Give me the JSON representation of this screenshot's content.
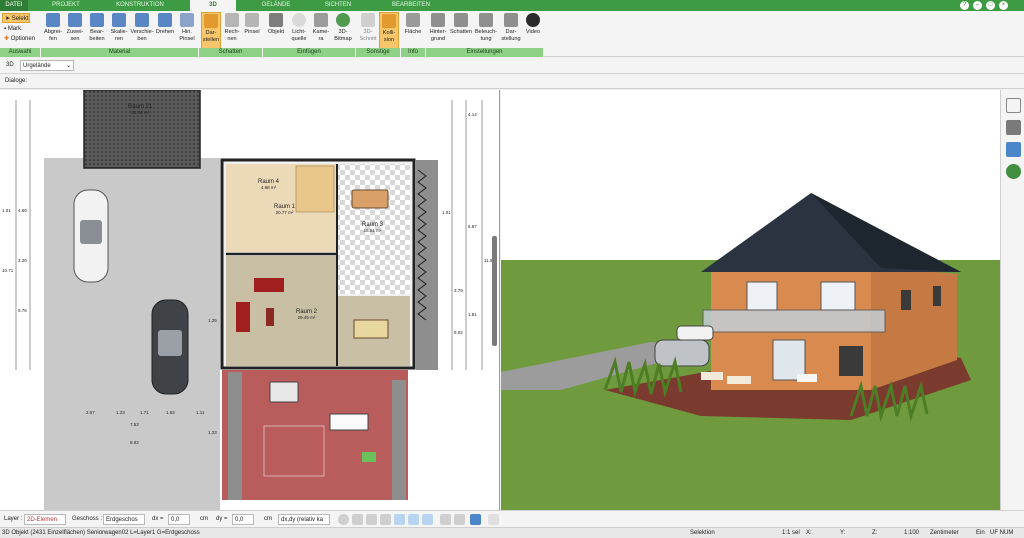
{
  "tabs": [
    "DATEI",
    "PROJEKT",
    "KONSTRUKTION",
    "3D",
    "GELÄNDE",
    "SICHTEN",
    "BEARBEITEN"
  ],
  "active_tab": "3D",
  "window_controls": [
    "?",
    "–",
    "□",
    "×"
  ],
  "ribbon": {
    "selection": {
      "select": "Selekt",
      "mark": "Mark.",
      "options": "Optionen"
    },
    "material": [
      {
        "label": "Abgrei-\nfen",
        "icon": "eyedropper-icon"
      },
      {
        "label": "Zuwei-\nsen",
        "icon": "assign-icon"
      },
      {
        "label": "Bear-\nbeiten",
        "icon": "edit-icon"
      },
      {
        "label": "Skalie-\nren",
        "icon": "scale-icon"
      },
      {
        "label": "Verschie-\nben",
        "icon": "move-icon"
      },
      {
        "label": "Drehen",
        "icon": "rotate-icon"
      },
      {
        "label": "Hin.\nPinsel",
        "icon": "brush-icon"
      }
    ],
    "shadows": [
      {
        "label": "Dar-\nstellen",
        "icon": "display-icon"
      },
      {
        "label": "Rech-\nnen",
        "icon": "calc-icon"
      },
      {
        "label": "Pinsel",
        "icon": "brush-icon"
      }
    ],
    "insert": [
      {
        "label": "Objekt",
        "icon": "object-icon"
      },
      {
        "label": "Licht-\nquelle",
        "icon": "light-icon"
      },
      {
        "label": "Kame-\nra",
        "icon": "camera-icon"
      },
      {
        "label": "3D-\nBitmap",
        "icon": "tree-icon"
      }
    ],
    "misc": [
      {
        "label": "3D-\nSchnitt",
        "icon": "section-icon"
      },
      {
        "label": "Kolli-\nsion",
        "icon": "collision-icon"
      }
    ],
    "info": [
      {
        "label": "Fläche",
        "icon": "area-icon"
      }
    ],
    "settings": [
      {
        "label": "Hinter-\ngrund",
        "icon": "background-icon"
      },
      {
        "label": "Schatten",
        "icon": "shadow-icon"
      },
      {
        "label": "Beleuch-\ntung",
        "icon": "lighting-icon"
      },
      {
        "label": "Dar-\nstellung",
        "icon": "render-icon"
      },
      {
        "label": "Video",
        "icon": "video-icon"
      }
    ],
    "groups": [
      "Auswahl",
      "Material",
      "Schatten",
      "Einfügen",
      "Sonstige",
      "Info",
      "Einstellungen"
    ]
  },
  "toolbar": {
    "mode": "3D",
    "terrain": "Urgelände"
  },
  "dialog_label": "Dialoge:",
  "plan": {
    "rooms": [
      {
        "name": "Raum 21",
        "area": "22.48 m²"
      },
      {
        "name": "Raum 4",
        "area": "4.88 m²"
      },
      {
        "name": "Raum 1",
        "area": "20.77 m²"
      },
      {
        "name": "Raum 3",
        "area": "16.51 m²"
      },
      {
        "name": "Raum 2",
        "area": "29.45 m²"
      }
    ],
    "dims_left": [
      "1.01",
      "4.60",
      "3.20",
      "10.71",
      "5.76",
      "1.25"
    ],
    "dims_right": [
      "4.14",
      "1.01",
      "6.97",
      "11.96",
      "3.79",
      "1.81",
      "8.02"
    ],
    "dims_bottom": [
      "2.57",
      "1.23",
      "1.71",
      "1.53",
      "1.11",
      "7.53",
      "8.92",
      "1.23"
    ]
  },
  "bottombar": {
    "layer_label": "Layer :",
    "layer_value": "2D-Elemen",
    "floor_label": "Geschoss :",
    "floor_value": "Erdgeschos",
    "dx_label": "dx =",
    "dx_value": "0,0",
    "dx_unit": "cm",
    "dy_label": "dy =",
    "dy_value": "0,0",
    "dy_unit": "cm",
    "mode_value": "dx,dy (relativ ka"
  },
  "statusbar": {
    "info": "3D Objekt (2431 Einzelflächen) Seniorwagen02 L=Layer1 G=Erdgeschoss",
    "selection": "Selektion",
    "sel_count": "1:1 sel",
    "x_label": "X:",
    "y_label": "Y:",
    "z_label": "Z:",
    "scale": "1:100",
    "unit": "Zentimeter",
    "snap": "Ein",
    "flags": "UF NUM"
  },
  "colors": {
    "accent": "#3d9b44",
    "highlight": "#f7c56a",
    "roof": "#2a3440",
    "wall": "#d98a4e",
    "grass": "#6f9a3d"
  }
}
